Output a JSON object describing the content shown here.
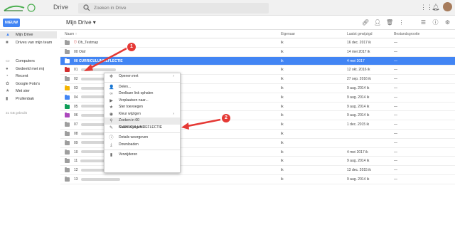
{
  "header": {
    "brand": "Drive",
    "search_placeholder": "Zoeken in Drive"
  },
  "toolbar": {
    "new_label": "NIEUW",
    "breadcrumb": "Mijn Drive ▾"
  },
  "sidebar": {
    "items": [
      {
        "label": "Mijn Drive",
        "icon": "drive-icon",
        "active": true
      },
      {
        "label": "Drives van mijn team",
        "icon": "team-drive-icon"
      },
      {
        "label": "Computers",
        "icon": "computer-icon"
      },
      {
        "label": "Gedeeld met mij",
        "icon": "shared-icon"
      },
      {
        "label": "Recent",
        "icon": "clock-icon"
      },
      {
        "label": "Google Foto's",
        "icon": "photos-icon"
      },
      {
        "label": "Met ster",
        "icon": "star-icon"
      },
      {
        "label": "Prullenbak",
        "icon": "trash-icon"
      }
    ],
    "quota": "31 GB gebruikt"
  },
  "table": {
    "headers": {
      "name": "Naam ↑",
      "owner": "Eigenaar",
      "modified": "Laatst gewijzigd",
      "size": "Bestandsgrootte"
    },
    "rows": [
      {
        "name": "Oh_Testmap",
        "owner": "ik",
        "modified": "16 dec. 2017 ik",
        "size": "—",
        "color": "#9e9e9e",
        "redmark": true
      },
      {
        "name": "00 Olaf",
        "owner": "ik",
        "modified": "14 mei 2017 ik",
        "size": "—",
        "color": "#9e9e9e"
      },
      {
        "name": "00 CURRICULUMREFLECTIE",
        "owner": "ik",
        "modified": "4 mei 2017",
        "size": "—",
        "color": "#9e9e9e",
        "selected": true
      },
      {
        "name": "01",
        "owner": "ik",
        "modified": "12 okt. 2016 ik",
        "size": "—",
        "color": "#d32f2f"
      },
      {
        "name": "02",
        "owner": "ik",
        "modified": "27 sep. 2016 ik",
        "size": "—",
        "color": "#9e9e9e"
      },
      {
        "name": "03",
        "owner": "ik",
        "modified": "9 aug. 2014 ik",
        "size": "—",
        "color": "#f4b400"
      },
      {
        "name": "04",
        "owner": "ik",
        "modified": "9 aug. 2014 ik",
        "size": "—",
        "color": "#4285f4"
      },
      {
        "name": "05",
        "owner": "ik",
        "modified": "9 aug. 2014 ik",
        "size": "—",
        "color": "#0f9d58"
      },
      {
        "name": "06",
        "owner": "ik",
        "modified": "9 aug. 2014 ik",
        "size": "—",
        "color": "#ab47bc"
      },
      {
        "name": "07",
        "owner": "ik",
        "modified": "1 dec. 2015 ik",
        "size": "—",
        "color": "#9e9e9e"
      },
      {
        "name": "08",
        "owner": "ik",
        "modified": "",
        "size": "—",
        "color": "#9e9e9e"
      },
      {
        "name": "09",
        "owner": "ik",
        "modified": "",
        "size": "—",
        "color": "#9e9e9e"
      },
      {
        "name": "10",
        "owner": "ik",
        "modified": "4 mei 2017 ik",
        "size": "—",
        "color": "#9e9e9e"
      },
      {
        "name": "11",
        "owner": "ik",
        "modified": "9 aug. 2014 ik",
        "size": "—",
        "color": "#9e9e9e"
      },
      {
        "name": "12",
        "owner": "ik",
        "modified": "13 dec. 2015 ik",
        "size": "—",
        "color": "#9e9e9e"
      },
      {
        "name": "13",
        "owner": "ik",
        "modified": "9 aug. 2014 ik",
        "size": "—",
        "color": "#9e9e9e"
      }
    ]
  },
  "context_menu": {
    "items": [
      {
        "label": "Openen met",
        "icon": "move-icon",
        "submenu": true
      },
      {
        "sep": true
      },
      {
        "label": "Delen...",
        "icon": "share-icon"
      },
      {
        "label": "Deelbare link ophalen",
        "icon": "link-icon"
      },
      {
        "label": "Verplaatsen naar...",
        "icon": "folder-move-icon"
      },
      {
        "label": "Ster toevoegen",
        "icon": "star-icon"
      },
      {
        "label": "Kleur wijzigen",
        "icon": "palette-icon",
        "submenu": true
      },
      {
        "label": "Zoeken in 00 CURRICULUMREFLECTIE",
        "icon": "search-icon",
        "highlight": true
      },
      {
        "label": "Naam wijzigen...",
        "icon": "rename-icon"
      },
      {
        "sep": true
      },
      {
        "label": "Details weergeven",
        "icon": "info-icon"
      },
      {
        "label": "Downloaden",
        "icon": "download-icon"
      },
      {
        "sep": true
      },
      {
        "label": "Verwijderen",
        "icon": "trash-icon"
      }
    ]
  },
  "annotations": {
    "callout1": "1",
    "callout2": "2",
    "color": "#e53935"
  }
}
